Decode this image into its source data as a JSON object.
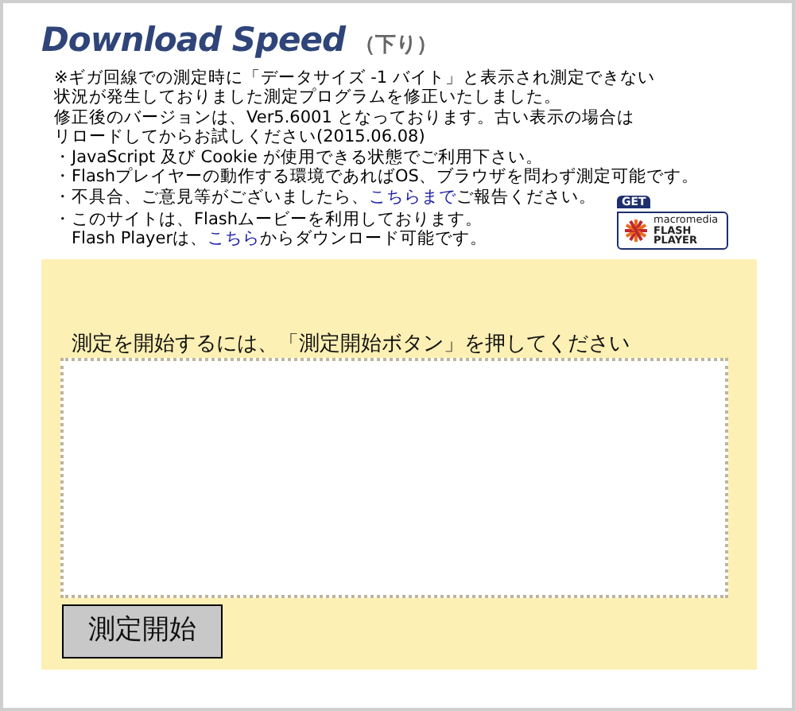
{
  "title": "Download Speed",
  "subtitle": "（下り）",
  "notes": [
    [
      {
        "text": "※ギガ回線での測定時に「データサイズ -1 バイト」と表示され測定できない"
      }
    ],
    [
      {
        "text": "状況が発生しておりました測定プログラムを修正いたしました。"
      }
    ],
    [
      {
        "text": "修正後のバージョンは、Ver5.6001 となっております。古い表示の場合は"
      }
    ],
    [
      {
        "text": "リロードしてからお試しください(2015.06.08)"
      }
    ],
    [
      {
        "text": "・JavaScript 及び Cookie が使用できる状態でご利用下さい。"
      }
    ],
    [
      {
        "text": "・Flashプレイヤーの動作する環境であればOS、ブラウザを問わず測定可能です。"
      }
    ],
    [
      {
        "text": "・不具合、ご意見等がございましたら、"
      },
      {
        "text": "こちらまで",
        "link": true
      },
      {
        "text": "ご報告ください。"
      }
    ],
    [
      {
        "text": "・このサイトは、Flashムービーを利用しております。"
      }
    ],
    [
      {
        "text": "　Flash Playerは、"
      },
      {
        "text": "こちら",
        "link": true
      },
      {
        "text": "からダウンロード可能です。"
      }
    ]
  ],
  "flash_badge": {
    "get": "GET",
    "brand": "macromedia",
    "product_lines": [
      "FLASH",
      "PLAYER"
    ]
  },
  "panel": {
    "instruction": "測定を開始するには、「測定開始ボタン」を押してください",
    "start_button": "測定開始"
  }
}
